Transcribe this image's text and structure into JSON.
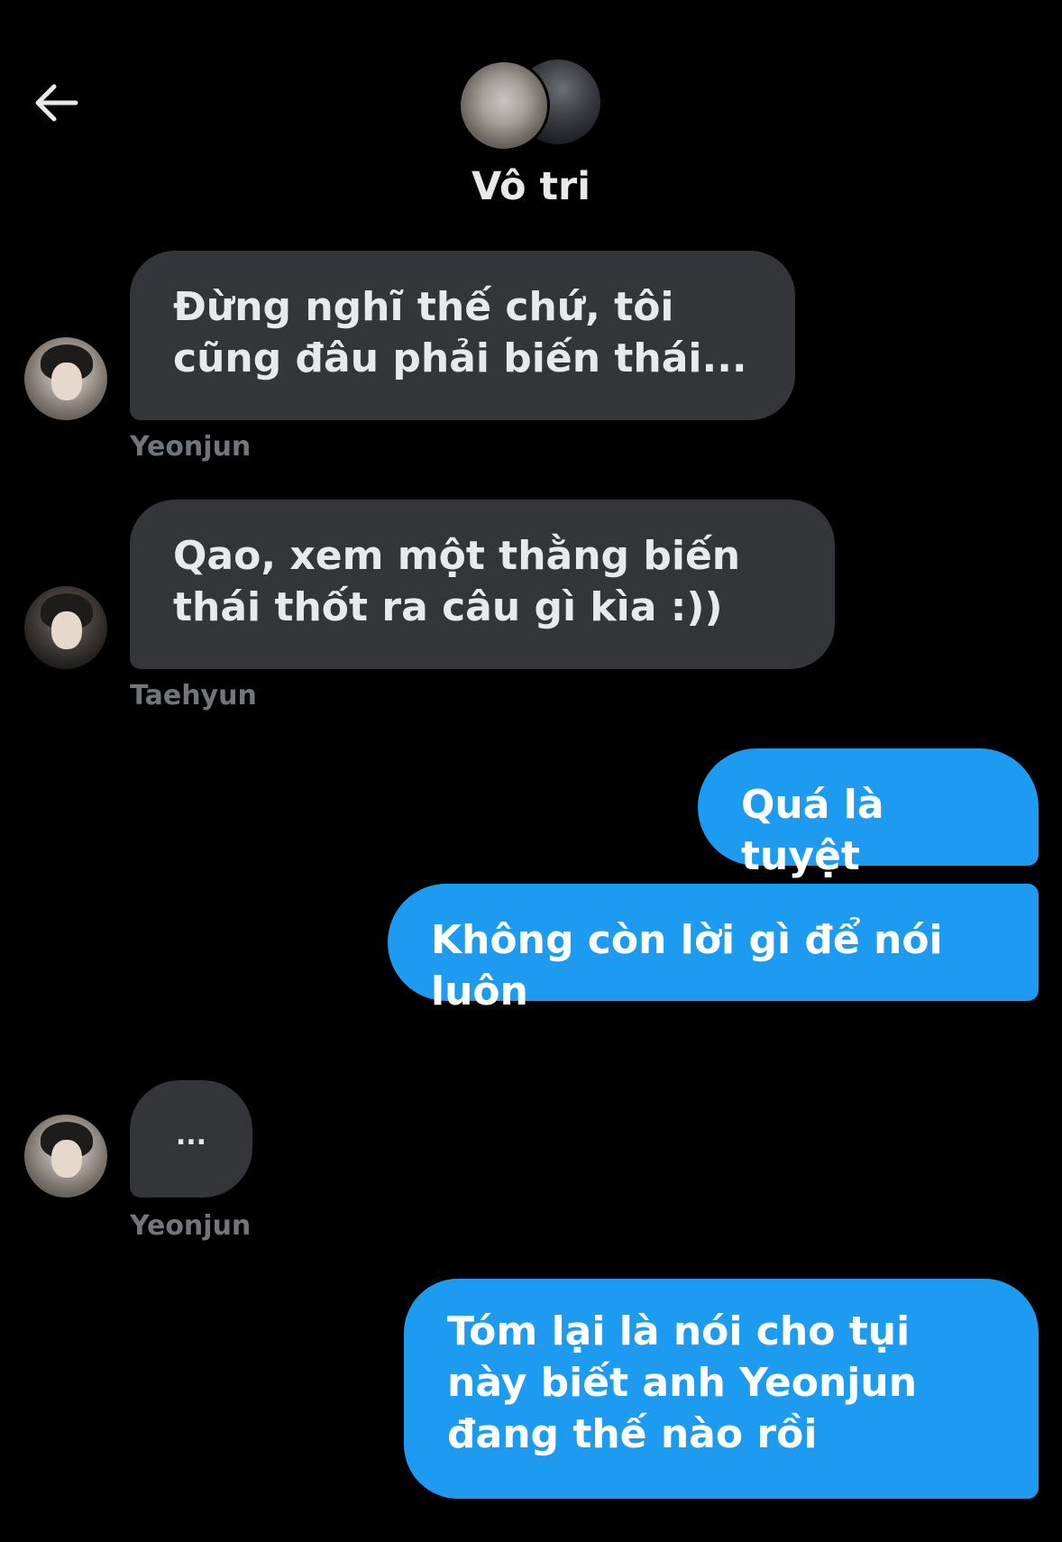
{
  "header": {
    "back_icon": "arrow-left-icon",
    "conversation_title": "Vô tri"
  },
  "messages": [
    {
      "sender": "Yeonjun",
      "direction": "incoming",
      "text": "Đừng nghĩ thế chứ, tôi cũng đâu phải biến thái..."
    },
    {
      "sender": "Taehyun",
      "direction": "incoming",
      "text": "Qao, xem một thằng biến thái thốt ra câu gì kìa :))"
    },
    {
      "direction": "outgoing",
      "text": "Quá là tuyệt"
    },
    {
      "direction": "outgoing",
      "text": "Không còn lời gì để nói luôn"
    },
    {
      "sender": "Yeonjun",
      "direction": "incoming",
      "text": "..."
    },
    {
      "direction": "outgoing",
      "text": "Tóm lại là nói cho tụi này biết anh Yeonjun đang thế nào rồi"
    }
  ],
  "colors": {
    "background": "#000000",
    "incoming_bubble": "#333539",
    "outgoing_bubble": "#1d9bf0",
    "sender_label": "#71767b",
    "primary_text": "#e7e9ea"
  }
}
